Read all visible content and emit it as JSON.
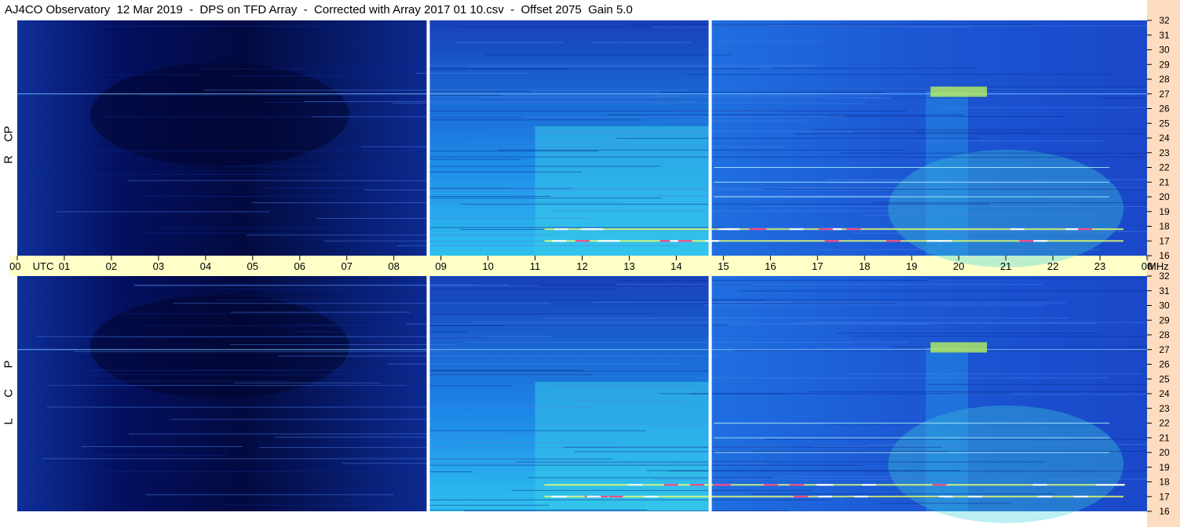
{
  "title": "AJ4CO Observatory  12 Mar 2019  -  DPS on TFD Array  -  Corrected with Array 2017 01 10.csv  -  Offset 2075  Gain 5.0",
  "chart_data": {
    "type": "heatmap",
    "time_axis": {
      "unit_label": "UTC",
      "ticks": [
        "00",
        "01",
        "02",
        "03",
        "04",
        "05",
        "06",
        "07",
        "08",
        "09",
        "10",
        "11",
        "12",
        "13",
        "14",
        "15",
        "16",
        "17",
        "18",
        "19",
        "20",
        "21",
        "22",
        "23",
        "00"
      ],
      "range_hours": [
        0,
        24
      ]
    },
    "freq_axis": {
      "unit_label": "MHz",
      "ticks": [
        16,
        17,
        18,
        19,
        20,
        21,
        22,
        23,
        24,
        25,
        26,
        27,
        28,
        29,
        30,
        31,
        32
      ],
      "range_mhz": [
        16,
        32
      ]
    },
    "panels": [
      {
        "polarization": "R C P",
        "letters": [
          "R",
          "C",
          "P"
        ]
      },
      {
        "polarization": "L C P",
        "letters": [
          "L",
          "C",
          "P"
        ]
      }
    ],
    "data_gaps_utc_hours": [
      8.73,
      14.72
    ],
    "colormap": [
      "#00002a",
      "#0b1f8c",
      "#1c52d4",
      "#1e90f0",
      "#34c6f0",
      "#5fe0c0",
      "#c8f060",
      "#ffff40",
      "#ff4080",
      "#ffffff"
    ],
    "interference_bands_mhz": [
      17.0,
      17.8,
      20.0,
      21.0,
      22.0,
      27.0
    ],
    "colors": {
      "night_background": "#061a6a",
      "day_background": "#1e96ee",
      "axis_band": "#ffffc8",
      "right_strip": "#fddcc0"
    }
  }
}
